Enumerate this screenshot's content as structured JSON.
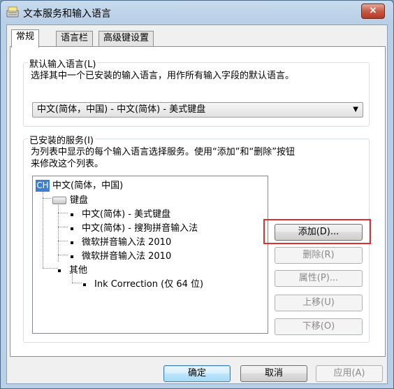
{
  "window": {
    "title": "文本服务和输入语言",
    "close_label": "×"
  },
  "tabs": [
    {
      "label": "常规",
      "active": true
    },
    {
      "label": "语言栏",
      "active": false
    },
    {
      "label": "高级键设置",
      "active": false
    }
  ],
  "default_language": {
    "group_title": "默认输入语言(L)",
    "description": "选择其中一个已安装的输入语言，用作所有输入字段的默认语言。",
    "selected": "中文(简体，中国) - 中文(简体) - 美式键盘"
  },
  "installed_services": {
    "group_title": "已安装的服务(I)",
    "description_line1": "为列表中显示的每个输入语言选择服务。使用“添加”和“删除”按钮",
    "description_line2": "来修改这个列表。",
    "tree": {
      "language_icon": "CH",
      "language": "中文(简体，中国)",
      "keyboard_group": "键盘",
      "keyboards": [
        "中文(简体) - 美式键盘",
        "中文(简体) - 搜狗拼音输入法",
        "微软拼音输入法 2010",
        "微软拼音输入法 2010"
      ],
      "other_group": "其他",
      "others": [
        "Ink Correction (仅 64 位)"
      ]
    },
    "buttons": {
      "add": "添加(D)...",
      "remove": "删除(R)",
      "properties": "属性(P)...",
      "move_up": "上移(U)",
      "move_down": "下移(O)"
    }
  },
  "footer": {
    "ok": "确定",
    "cancel": "取消",
    "apply": "应用(A)"
  },
  "colors": {
    "highlight": "#e03030",
    "language_icon_bg": "#3d7fd0"
  },
  "icons": [
    "keyboard-settings-icon",
    "close-icon",
    "chinese-language-icon",
    "keyboard-icon",
    "dropdown-arrow-icon"
  ]
}
